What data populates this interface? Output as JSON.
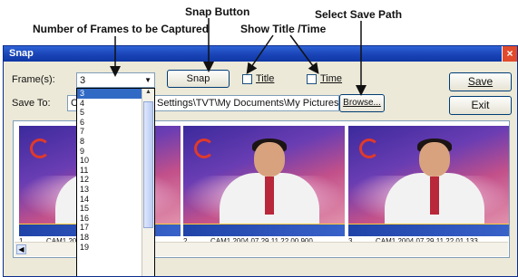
{
  "annotations": {
    "snap_button": "Snap Button",
    "select_save_path": "Select Save Path",
    "frames_to_capture": "Number of Frames to be Captured",
    "show_title_time": "Show Title /Time"
  },
  "window": {
    "title": "Snap",
    "close_glyph": "×"
  },
  "frames_label": "Frame(s):",
  "frames_selected": "3",
  "frames_options": [
    "3",
    "4",
    "5",
    "6",
    "7",
    "8",
    "9",
    "10",
    "11",
    "12",
    "13",
    "14",
    "15",
    "16",
    "17",
    "18",
    "19"
  ],
  "snap_label": "Snap",
  "title_checkbox_label": "Title",
  "time_checkbox_label": "Time",
  "save_button_label": "Save",
  "exit_button_label": "Exit",
  "save_to_label": "Save To:",
  "save_path_visible": "C:",
  "save_path_tail": "Settings\\TVT\\My Documents\\My Pictures",
  "browse_label": "Browse...",
  "thumbnails": [
    {
      "index": "1",
      "caption": "CAM1.2004.07.29.11.22.00.588"
    },
    {
      "index": "2",
      "caption": "CAM1.2004.07.29.11.22.00.900"
    },
    {
      "index": "3",
      "caption": "CAM1.2004.07.29.11.22.01.133"
    }
  ],
  "colors": {
    "titlebar": "#1b46b9",
    "dialog_bg": "#ece9d8",
    "selection": "#316ac5"
  }
}
